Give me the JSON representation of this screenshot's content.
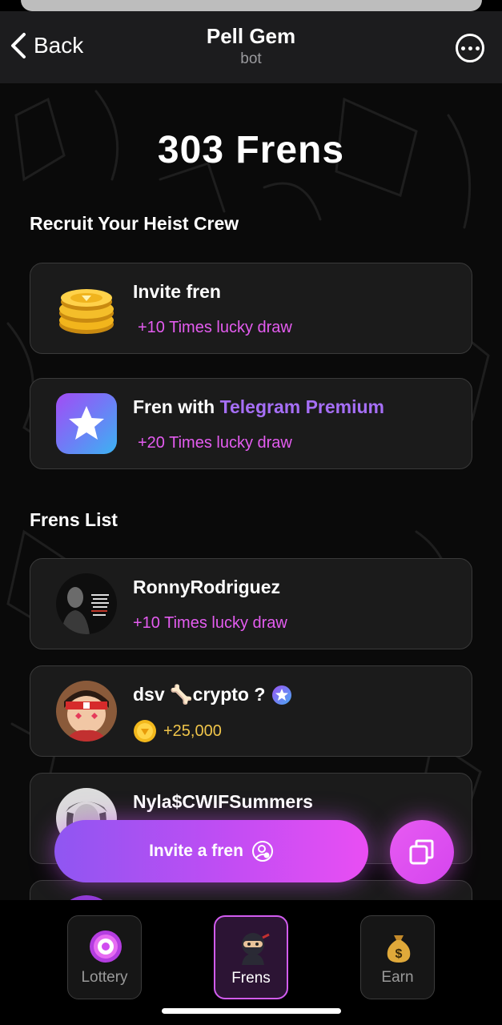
{
  "header": {
    "back_label": "Back",
    "title": "Pell Gem",
    "subtitle": "bot"
  },
  "main": {
    "frens_count_heading": "303 Frens",
    "recruit_title": "Recruit Your Heist Crew",
    "invite_card": {
      "title": "Invite fren",
      "reward": "+10 Times lucky draw"
    },
    "premium_card": {
      "title_prefix": "Fren with ",
      "title_accent": "Telegram Premium",
      "reward": "+20 Times lucky draw"
    },
    "frens_list_title": "Frens List",
    "frens": [
      {
        "name": "RonnyRodriguez",
        "reward": "+10 Times lucky draw",
        "reward_type": "lucky_draw"
      },
      {
        "name": "dsv 🦴crypto ?",
        "reward": "+25,000",
        "reward_type": "gem",
        "premium": true
      },
      {
        "name": "Nyla$CWIFSummers",
        "reward": "",
        "reward_type": "lucky_draw"
      }
    ]
  },
  "actions": {
    "invite_button_label": "Invite a fren"
  },
  "nav": {
    "items": [
      {
        "label": "Lottery",
        "icon": "lottery-wheel-icon",
        "active": false
      },
      {
        "label": "Frens",
        "icon": "ninja-icon",
        "active": true
      },
      {
        "label": "Earn",
        "icon": "money-bag-icon",
        "active": false
      }
    ]
  },
  "colors": {
    "accent_pink": "#e45cf0",
    "accent_purple": "#a66ff7",
    "gold": "#f0c54a",
    "card_bg": "#1b1b1b"
  }
}
